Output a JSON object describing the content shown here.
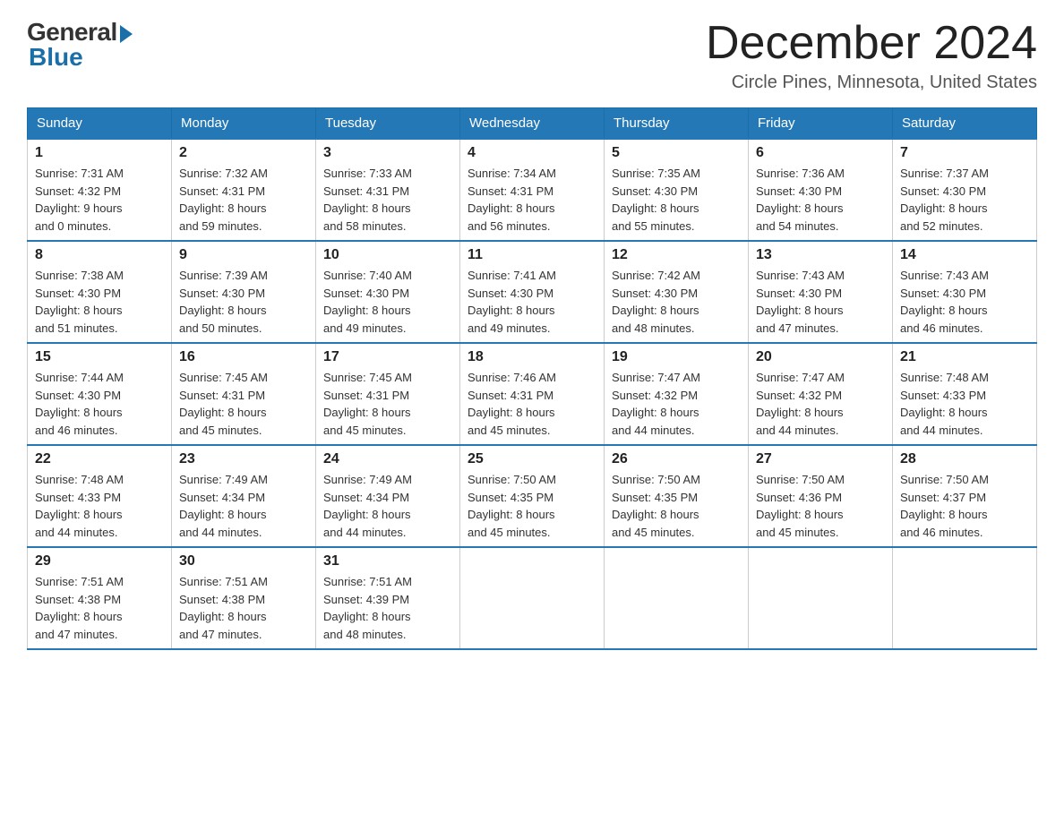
{
  "logo": {
    "general": "General",
    "blue": "Blue"
  },
  "header": {
    "month": "December 2024",
    "location": "Circle Pines, Minnesota, United States"
  },
  "days_of_week": [
    "Sunday",
    "Monday",
    "Tuesday",
    "Wednesday",
    "Thursday",
    "Friday",
    "Saturday"
  ],
  "weeks": [
    [
      {
        "day": "1",
        "sunrise": "7:31 AM",
        "sunset": "4:32 PM",
        "daylight": "9 hours and 0 minutes."
      },
      {
        "day": "2",
        "sunrise": "7:32 AM",
        "sunset": "4:31 PM",
        "daylight": "8 hours and 59 minutes."
      },
      {
        "day": "3",
        "sunrise": "7:33 AM",
        "sunset": "4:31 PM",
        "daylight": "8 hours and 58 minutes."
      },
      {
        "day": "4",
        "sunrise": "7:34 AM",
        "sunset": "4:31 PM",
        "daylight": "8 hours and 56 minutes."
      },
      {
        "day": "5",
        "sunrise": "7:35 AM",
        "sunset": "4:30 PM",
        "daylight": "8 hours and 55 minutes."
      },
      {
        "day": "6",
        "sunrise": "7:36 AM",
        "sunset": "4:30 PM",
        "daylight": "8 hours and 54 minutes."
      },
      {
        "day": "7",
        "sunrise": "7:37 AM",
        "sunset": "4:30 PM",
        "daylight": "8 hours and 52 minutes."
      }
    ],
    [
      {
        "day": "8",
        "sunrise": "7:38 AM",
        "sunset": "4:30 PM",
        "daylight": "8 hours and 51 minutes."
      },
      {
        "day": "9",
        "sunrise": "7:39 AM",
        "sunset": "4:30 PM",
        "daylight": "8 hours and 50 minutes."
      },
      {
        "day": "10",
        "sunrise": "7:40 AM",
        "sunset": "4:30 PM",
        "daylight": "8 hours and 49 minutes."
      },
      {
        "day": "11",
        "sunrise": "7:41 AM",
        "sunset": "4:30 PM",
        "daylight": "8 hours and 49 minutes."
      },
      {
        "day": "12",
        "sunrise": "7:42 AM",
        "sunset": "4:30 PM",
        "daylight": "8 hours and 48 minutes."
      },
      {
        "day": "13",
        "sunrise": "7:43 AM",
        "sunset": "4:30 PM",
        "daylight": "8 hours and 47 minutes."
      },
      {
        "day": "14",
        "sunrise": "7:43 AM",
        "sunset": "4:30 PM",
        "daylight": "8 hours and 46 minutes."
      }
    ],
    [
      {
        "day": "15",
        "sunrise": "7:44 AM",
        "sunset": "4:30 PM",
        "daylight": "8 hours and 46 minutes."
      },
      {
        "day": "16",
        "sunrise": "7:45 AM",
        "sunset": "4:31 PM",
        "daylight": "8 hours and 45 minutes."
      },
      {
        "day": "17",
        "sunrise": "7:45 AM",
        "sunset": "4:31 PM",
        "daylight": "8 hours and 45 minutes."
      },
      {
        "day": "18",
        "sunrise": "7:46 AM",
        "sunset": "4:31 PM",
        "daylight": "8 hours and 45 minutes."
      },
      {
        "day": "19",
        "sunrise": "7:47 AM",
        "sunset": "4:32 PM",
        "daylight": "8 hours and 44 minutes."
      },
      {
        "day": "20",
        "sunrise": "7:47 AM",
        "sunset": "4:32 PM",
        "daylight": "8 hours and 44 minutes."
      },
      {
        "day": "21",
        "sunrise": "7:48 AM",
        "sunset": "4:33 PM",
        "daylight": "8 hours and 44 minutes."
      }
    ],
    [
      {
        "day": "22",
        "sunrise": "7:48 AM",
        "sunset": "4:33 PM",
        "daylight": "8 hours and 44 minutes."
      },
      {
        "day": "23",
        "sunrise": "7:49 AM",
        "sunset": "4:34 PM",
        "daylight": "8 hours and 44 minutes."
      },
      {
        "day": "24",
        "sunrise": "7:49 AM",
        "sunset": "4:34 PM",
        "daylight": "8 hours and 44 minutes."
      },
      {
        "day": "25",
        "sunrise": "7:50 AM",
        "sunset": "4:35 PM",
        "daylight": "8 hours and 45 minutes."
      },
      {
        "day": "26",
        "sunrise": "7:50 AM",
        "sunset": "4:35 PM",
        "daylight": "8 hours and 45 minutes."
      },
      {
        "day": "27",
        "sunrise": "7:50 AM",
        "sunset": "4:36 PM",
        "daylight": "8 hours and 45 minutes."
      },
      {
        "day": "28",
        "sunrise": "7:50 AM",
        "sunset": "4:37 PM",
        "daylight": "8 hours and 46 minutes."
      }
    ],
    [
      {
        "day": "29",
        "sunrise": "7:51 AM",
        "sunset": "4:38 PM",
        "daylight": "8 hours and 47 minutes."
      },
      {
        "day": "30",
        "sunrise": "7:51 AM",
        "sunset": "4:38 PM",
        "daylight": "8 hours and 47 minutes."
      },
      {
        "day": "31",
        "sunrise": "7:51 AM",
        "sunset": "4:39 PM",
        "daylight": "8 hours and 48 minutes."
      },
      null,
      null,
      null,
      null
    ]
  ],
  "labels": {
    "sunrise": "Sunrise:",
    "sunset": "Sunset:",
    "daylight": "Daylight:"
  }
}
